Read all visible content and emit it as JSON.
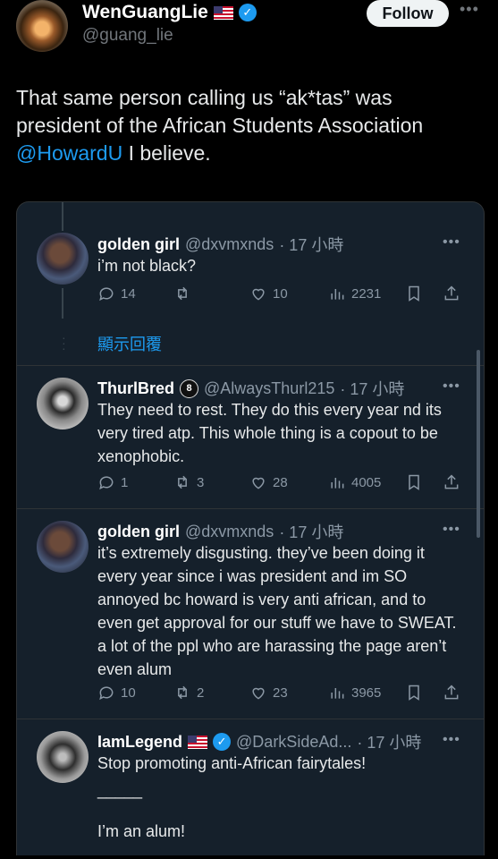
{
  "author": {
    "name": "WenGuangLie",
    "handle": "@guang_lie",
    "follow_label": "Follow"
  },
  "tweet": {
    "text_before": "That same person calling us “ak*tas” was president of the African Students Association ",
    "mention": "@HowardU",
    "text_after": " I believe."
  },
  "replies": [
    {
      "name": "golden girl",
      "handle": "@dxvmxnds",
      "time": "· 17 小時",
      "text": "i’m not black?",
      "replies": "14",
      "retweets": "",
      "likes": "10",
      "views": "2231"
    },
    {
      "show_replies": "顯示回覆"
    },
    {
      "name": "ThurlBred",
      "handle": "@AlwaysThurl215",
      "time": "· 17 小時",
      "text": "They need to rest. They do this every year nd its very tired atp. This whole thing is a copout to be xenophobic.",
      "replies": "1",
      "retweets": "3",
      "likes": "28",
      "views": "4005"
    },
    {
      "name": "golden girl",
      "handle": "@dxvmxnds",
      "time": "· 17 小時",
      "text": "it’s extremely disgusting. they’ve been doing it every year since i was president and im SO annoyed bc howard is very anti african, and to even get approval for our stuff we have to SWEAT. a lot of the ppl who are harassing the page aren’t even alum",
      "replies": "10",
      "retweets": "2",
      "likes": "23",
      "views": "3965"
    },
    {
      "name": "IamLegend",
      "handle": "@DarkSideAd...",
      "time": "· 17 小時",
      "text_line1": "Stop promoting anti-African fairytales!",
      "text_line2": "_____",
      "text_line3": "I’m an alum!"
    }
  ],
  "colors": {
    "accent": "#1d9bf0",
    "card_bg": "#15202b",
    "muted": "#8b98a5"
  }
}
